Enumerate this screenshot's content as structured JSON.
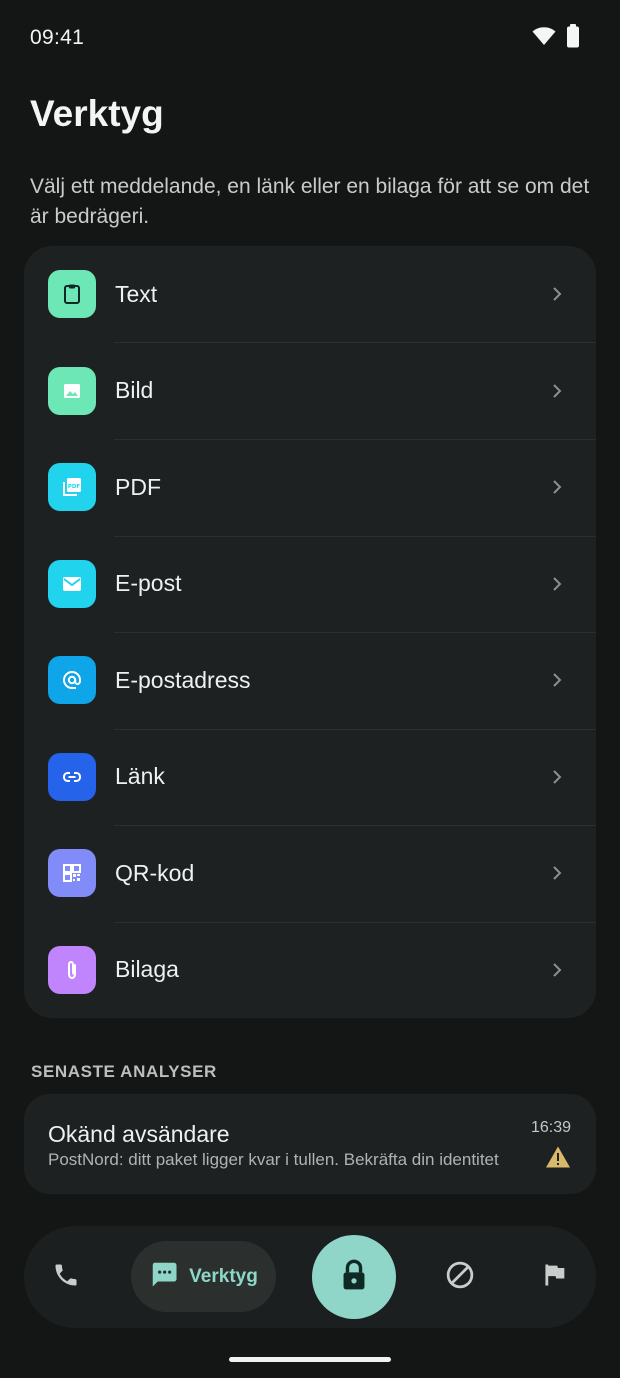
{
  "status_bar": {
    "time": "09:41",
    "icons": [
      "wifi-icon",
      "battery-icon"
    ]
  },
  "header": {
    "title": "Verktyg",
    "subtitle": "Välj ett meddelande, en länk eller en bilaga för att se om det är bedrägeri."
  },
  "tools": [
    {
      "label": "Text",
      "icon": "clipboard-icon",
      "color": "#6ee7b7"
    },
    {
      "label": "Bild",
      "icon": "image-icon",
      "color": "#6ee7b7"
    },
    {
      "label": "PDF",
      "icon": "pdf-icon",
      "color": "#22d3ee"
    },
    {
      "label": "E-post",
      "icon": "mail-icon",
      "color": "#22d3ee"
    },
    {
      "label": "E-postadress",
      "icon": "at-sign-icon",
      "color": "#0ea5e9"
    },
    {
      "label": "Länk",
      "icon": "link-icon",
      "color": "#2563eb"
    },
    {
      "label": "QR-kod",
      "icon": "qr-code-icon",
      "color": "#818cf8"
    },
    {
      "label": "Bilaga",
      "icon": "paperclip-icon",
      "color": "#c084fc"
    }
  ],
  "recent": {
    "section_title": "SENASTE ANALYSER",
    "items": [
      {
        "sender": "Okänd avsändare",
        "preview": "PostNord: ditt paket ligger kvar i tullen. Bekräfta din identitet",
        "time": "16:39",
        "status_icon": "warning-icon",
        "status_color": "#d8b86b"
      }
    ]
  },
  "bottom_nav": {
    "items": [
      {
        "icon": "phone-icon"
      },
      {
        "icon": "chat-icon",
        "label": "Verktyg",
        "active": true
      },
      {
        "icon": "lock-icon"
      },
      {
        "icon": "block-icon"
      },
      {
        "icon": "flag-icon"
      }
    ],
    "accent": "#8fd6c8"
  }
}
